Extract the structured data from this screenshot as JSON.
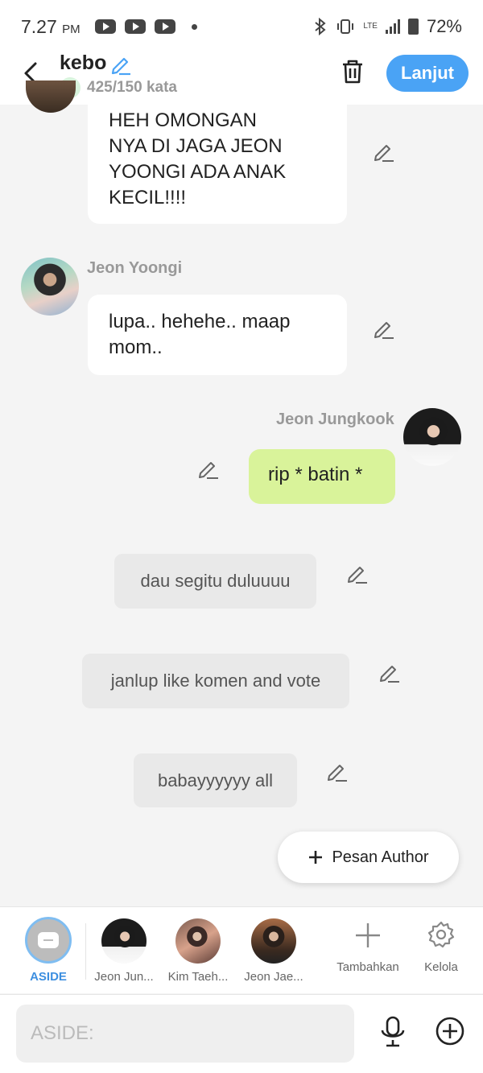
{
  "status_bar": {
    "time": "7.27",
    "ampm": "PM",
    "lte": "LTE",
    "battery": "72%"
  },
  "header": {
    "title": "kebo",
    "word_count": "425/150 kata",
    "next_button": "Lanjut"
  },
  "messages": [
    {
      "sender": "",
      "text_lines": [
        "HEH OMONGAN",
        "NYA DI JAGA JEON",
        "YOONGI ADA ANAK",
        "KECIL!!!!"
      ]
    },
    {
      "sender": "Jeon Yoongi",
      "text_lines": [
        "lupa.. hehehe.. maap",
        "mom.."
      ]
    },
    {
      "sender": "Jeon Jungkook",
      "text": "rip * batin *"
    }
  ],
  "narrations": [
    "dau segitu duluuuu",
    "janlup like komen and vote",
    "babayyyyyy all"
  ],
  "fab": {
    "label": "Pesan Author"
  },
  "character_bar": {
    "aside": "ASIDE",
    "characters": [
      "Jeon Jun...",
      "Kim Taeh...",
      "Jeon Jae..."
    ],
    "add": "Tambahkan",
    "manage": "Kelola"
  },
  "input": {
    "placeholder": "ASIDE:"
  },
  "colors": {
    "accent": "#4aa3f5",
    "my_bubble": "#d9f39a",
    "narration_bg": "#e9e9e9"
  }
}
